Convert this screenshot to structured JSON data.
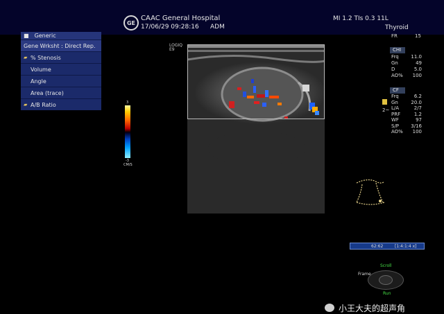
{
  "header": {
    "logo": "GE",
    "hospital": "CAAC General Hospital",
    "datetime": "17/06/29 09:28:16",
    "operator": "ADM",
    "mi_tis": "MI 1.2   TIs 0.3 11L",
    "exam": "Thyroid",
    "fr_label": "FR",
    "fr_value": "15"
  },
  "menu": {
    "title": "Generic",
    "subtitle": "Gene Wrksht : Direct Rep.",
    "items": [
      {
        "label": "% Stenosis",
        "icon": "folder-icon"
      },
      {
        "label": "Volume"
      },
      {
        "label": "Angle"
      },
      {
        "label": "Area (trace)"
      },
      {
        "label": "A/B Ratio",
        "icon": "folder-icon"
      }
    ]
  },
  "color_scale": {
    "top": "3",
    "bottom": "-3",
    "unit": "CM/S"
  },
  "probe": {
    "line1": "LOGIQ",
    "line2": "E9"
  },
  "chi": {
    "title": "CHI",
    "params": [
      {
        "k": "Frq",
        "v": "11.0"
      },
      {
        "k": "Gn",
        "v": "49"
      },
      {
        "k": "D",
        "v": "5.0"
      },
      {
        "k": "AO%",
        "v": "100"
      }
    ]
  },
  "cf": {
    "title": "CF",
    "params": [
      {
        "k": "Frq",
        "v": "6.2"
      },
      {
        "k": "Gn",
        "v": "20.0"
      },
      {
        "k": "L/A",
        "v": "2/7"
      },
      {
        "k": "PRF",
        "v": "1.2"
      },
      {
        "k": "WF",
        "v": "97"
      },
      {
        "k": "S/P",
        "v": "3/16"
      },
      {
        "k": "AO%",
        "v": "100"
      }
    ],
    "marker": "2~"
  },
  "frame_bar": {
    "left": "62:62",
    "right": "[1:4:1:4 x]"
  },
  "cine": {
    "scroll": "Scroll",
    "frame": "Frame",
    "run": "Run"
  },
  "watermark": "小王大夫的超声角"
}
